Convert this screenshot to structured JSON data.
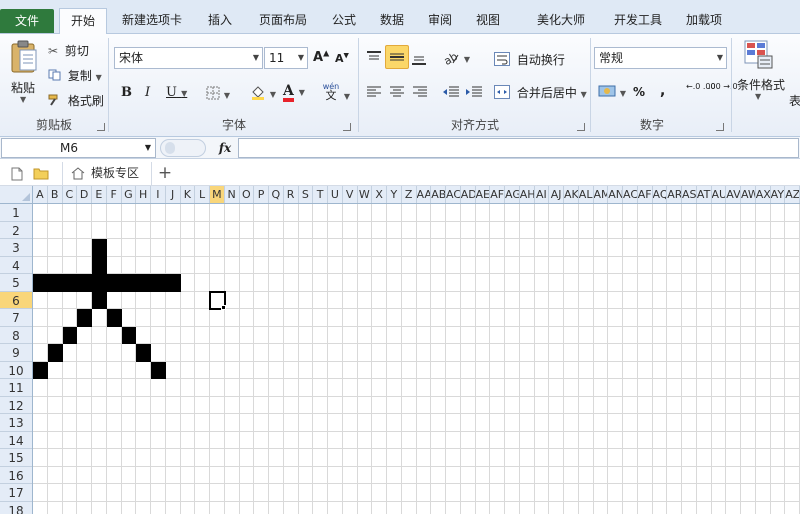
{
  "tabs": [
    {
      "label": "文件",
      "name": "tab-file"
    },
    {
      "label": "开始",
      "name": "tab-home"
    },
    {
      "label": "新建选项卡",
      "name": "tab-new-tab"
    },
    {
      "label": "插入",
      "name": "tab-insert"
    },
    {
      "label": "页面布局",
      "name": "tab-page-layout"
    },
    {
      "label": "公式",
      "name": "tab-formulas"
    },
    {
      "label": "数据",
      "name": "tab-data"
    },
    {
      "label": "审阅",
      "name": "tab-review"
    },
    {
      "label": "视图",
      "name": "tab-view"
    },
    {
      "label": "美化大师",
      "name": "tab-beautify"
    },
    {
      "label": "开发工具",
      "name": "tab-developer"
    },
    {
      "label": "加载项",
      "name": "tab-addins"
    }
  ],
  "clipboard": {
    "paste": "粘贴",
    "cut": "剪切",
    "copy": "复制",
    "format_painter": "格式刷",
    "label": "剪贴板"
  },
  "font": {
    "name": "宋体",
    "size": "11",
    "label": "字体",
    "bold": "B",
    "italic": "I",
    "underline": "U",
    "font_color_letter": "A",
    "phonetic": "wén"
  },
  "alignment": {
    "wrap_text": "自动换行",
    "merge_center": "合并后居中",
    "label": "对齐方式"
  },
  "number": {
    "format": "常规",
    "label": "数字",
    "percent": "%",
    "comma": ",",
    "inc_decimal": "←.0 .00",
    "dec_decimal": ".00 →.0"
  },
  "styles": {
    "conditional_format": "条件格式",
    "next_truncated": "表"
  },
  "formula_bar": {
    "name_box": "M6",
    "fx": "fx",
    "value": ""
  },
  "doc_tabs": {
    "template_zone": "模板专区",
    "add": "+"
  },
  "sheet": {
    "columns": [
      "A",
      "B",
      "C",
      "D",
      "E",
      "F",
      "G",
      "H",
      "I",
      "J",
      "K",
      "L",
      "M",
      "N",
      "O",
      "P",
      "Q",
      "R",
      "S",
      "T",
      "U",
      "V",
      "W",
      "X",
      "Y",
      "Z",
      "AA",
      "AB",
      "AC",
      "AD",
      "AE",
      "AF",
      "AG",
      "AH",
      "AI",
      "AJ",
      "AK",
      "AL",
      "AM",
      "AN",
      "AC",
      "AF",
      "AQ",
      "AR",
      "AS",
      "AT",
      "AU",
      "AV",
      "AW",
      "AX",
      "AY",
      "AZ"
    ],
    "rows": [
      "1",
      "2",
      "3",
      "4",
      "5",
      "6",
      "7",
      "8",
      "9",
      "10",
      "11",
      "12",
      "13",
      "14",
      "15",
      "16",
      "17",
      "18"
    ],
    "selected_column": "M",
    "selected_row": "6",
    "active_cell": "M6",
    "filled_cells": [
      "E3",
      "E4",
      "A5",
      "B5",
      "C5",
      "D5",
      "E5",
      "F5",
      "G5",
      "H5",
      "I5",
      "J5",
      "E6",
      "D7",
      "F7",
      "C8",
      "G8",
      "B9",
      "H9",
      "A10",
      "I10"
    ]
  },
  "colors": {
    "file_tab": "#2f7a3d",
    "header_selected": "#f9d67a",
    "cell_fill": "#000000",
    "gridline": "#d9d9d9"
  }
}
